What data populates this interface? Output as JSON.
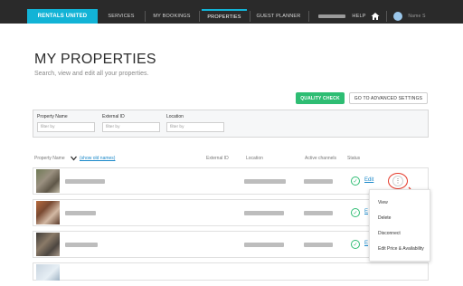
{
  "header": {
    "brand": "RENTALS UNITED",
    "nav": [
      "SERVICES",
      "MY BOOKINGS",
      "PROPERTIES",
      "GUEST PLANNER"
    ],
    "help": "HELP",
    "user_name": "Name S"
  },
  "page": {
    "title": "MY PROPERTIES",
    "subtitle": "Search, view and edit all your properties."
  },
  "actions": {
    "quality_check": "QUALITY CHECK",
    "advanced_settings": "GO TO ADVANCED SETTINGS"
  },
  "filters": [
    {
      "label": "Property Name",
      "placeholder": "filter by"
    },
    {
      "label": "External ID",
      "placeholder": "filter by"
    },
    {
      "label": "Location",
      "placeholder": "filter by"
    }
  ],
  "table": {
    "headers": {
      "property_name": "Property Name",
      "show_old_names": "(show old names)",
      "external_id": "External ID",
      "location": "Location",
      "active_channels": "Active channels",
      "status": "Status"
    },
    "rows": [
      {
        "edit": "Edit"
      },
      {
        "edit": "E"
      },
      {
        "edit": "E"
      }
    ]
  },
  "context_menu": [
    "View",
    "Delete",
    "Disconnect",
    "Edit Price & Availability"
  ],
  "colors": {
    "brand": "#12b3d6",
    "accent_green": "#2ebd73",
    "link_blue": "#1a88c9",
    "annotation_red": "#e53b2c"
  }
}
